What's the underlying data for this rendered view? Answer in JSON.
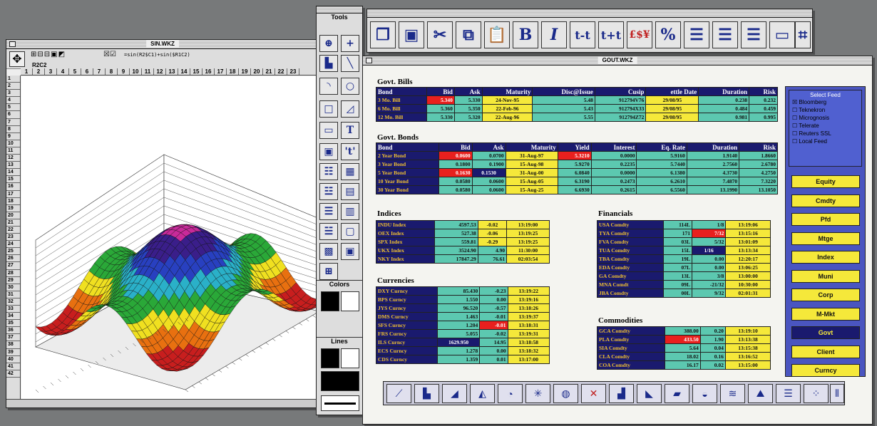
{
  "tools": {
    "title": "Tools",
    "colors_label": "Colors",
    "lines_label": "Lines"
  },
  "sheet": {
    "title": "SIN.WKZ",
    "cell_ref": "R2C2",
    "formula": "=sin(R2$C1)+sin($R1C2)",
    "columns": [
      "1",
      "2",
      "3",
      "4",
      "5",
      "6",
      "7",
      "8",
      "9",
      "10",
      "11",
      "12",
      "13",
      "14",
      "15",
      "16",
      "17",
      "18",
      "19",
      "20",
      "21",
      "22",
      "23"
    ],
    "rows": [
      "1",
      "2",
      "3",
      "4",
      "5",
      "6",
      "7",
      "8",
      "9",
      "10",
      "11",
      "12",
      "13",
      "14",
      "15",
      "16",
      "17",
      "18",
      "19",
      "20",
      "21",
      "22",
      "23",
      "24",
      "25",
      "26",
      "27",
      "28",
      "29",
      "30",
      "31",
      "32",
      "33",
      "34",
      "35",
      "36",
      "37",
      "38",
      "39",
      "40",
      "41",
      "42"
    ]
  },
  "main": {
    "title": "GOUT.WKZ",
    "bills": {
      "title": "Govt. Bills",
      "headers": [
        "Bond",
        "Bid",
        "Ask",
        "Maturity",
        "Disc@Issue",
        "Cusip",
        "ettle Date",
        "Duration",
        "Risk"
      ],
      "rows": [
        [
          "3 Mo. Bill",
          "5.340",
          "5.330",
          "24-Nov-95",
          "5.48",
          "912794V76",
          "29/08/95",
          "0.238",
          "0.232"
        ],
        [
          "6 Mo. Bill",
          "5.360",
          "5.350",
          "22-Feb-96",
          "5.43",
          "912794X33",
          "29/08/95",
          "0.484",
          "0.459"
        ],
        [
          "12 Mo. Bill",
          "5.330",
          "5.320",
          "22-Aug-96",
          "5.55",
          "912794Z72",
          "29/08/95",
          "0.981",
          "0.995"
        ]
      ]
    },
    "bonds": {
      "title": "Govt. Bonds",
      "headers": [
        "Bond",
        "Bid",
        "Ask",
        "Maturity",
        "Yield",
        "Interest",
        "Eq. Rate",
        "Duration",
        "Risk"
      ],
      "rows": [
        [
          "2 Year Bond",
          "0.0600",
          "0.0700",
          "31-Aug-97",
          "5.3210",
          "0.0000",
          "5.9160",
          "1.9140",
          "1.8660"
        ],
        [
          "3 Year Bond",
          "0.1800",
          "0.1900",
          "15-Aug-98",
          "5.9270",
          "0.2235",
          "5.7440",
          "2.7560",
          "2.6780"
        ],
        [
          "5 Year Bond",
          "0.1630",
          "0.1530",
          "31-Aug-00",
          "6.0840",
          "0.0000",
          "6.1380",
          "4.3730",
          "4.2750"
        ],
        [
          "10 Year Bond",
          "0.0580",
          "0.0600",
          "15-Aug-05",
          "6.3190",
          "0.2473",
          "6.2610",
          "7.4870",
          "7.3220"
        ],
        [
          "30 Year Bond",
          "0.0580",
          "0.0600",
          "15-Aug-25",
          "6.6930",
          "0.2615",
          "6.5560",
          "13.1990",
          "13.1050"
        ]
      ]
    },
    "indices": {
      "title": "Indices",
      "rows": [
        [
          "INDU Index",
          "4597.53",
          "-0.02",
          "13:19:00"
        ],
        [
          "OEX Index",
          "527.38",
          "-0.06",
          "13:19:25"
        ],
        [
          "SPX Index",
          "559.81",
          "-0.29",
          "13:19:25"
        ],
        [
          "UKX Index",
          "3524.90",
          "4.90",
          "11:30:00"
        ],
        [
          "NKY Index",
          "17847.29",
          "76.61",
          "02:03:54"
        ]
      ]
    },
    "currencies": {
      "title": "Currencies",
      "rows": [
        [
          "DXY Curncy",
          "85.430",
          "-0.23",
          "13:19:22"
        ],
        [
          "BPS Curncy",
          "1.550",
          "0.00",
          "13:19:16"
        ],
        [
          "JYS Curncy",
          "96.520",
          "-0.57",
          "13:18:26"
        ],
        [
          "DMS Curncy",
          "1.463",
          "-0.01",
          "13:19:37"
        ],
        [
          "SFS Curncy",
          "1.204",
          "-0.01",
          "13:18:31"
        ],
        [
          "FRS Curncy",
          "5.055",
          "-0.02",
          "13:19:31"
        ],
        [
          "ILS Curncy",
          "1629.950",
          "14.95",
          "13:18:58"
        ],
        [
          "ECS Curncy",
          "1.278",
          "0.00",
          "13:18:32"
        ],
        [
          "CDS Curncy",
          "1.359",
          "0.01",
          "13:17:00"
        ]
      ]
    },
    "financials": {
      "title": "Financials",
      "rows": [
        [
          "USA Comdty",
          "114L",
          "1/8",
          "13:19:06"
        ],
        [
          "TYA Comdty",
          "171",
          "7/32",
          "13:15:16"
        ],
        [
          "FVA Comdty",
          "03L",
          "5/32",
          "13:01:09"
        ],
        [
          "TUA Comdty",
          "15L",
          "1/16",
          "13:13:34"
        ],
        [
          "TBA Comdty",
          "19L",
          "0.00",
          "12:20:17"
        ],
        [
          "EDA Comdty",
          "07L",
          "0.00",
          "13:06:25"
        ],
        [
          "GA Comdty",
          "13L",
          "3/8",
          "13:00:00"
        ],
        [
          "MNA Comdt",
          "09L",
          "-21/32",
          "10:30:00"
        ],
        [
          "JBA Comdty",
          "00L",
          "9/32",
          "02:01:31"
        ]
      ]
    },
    "commodities": {
      "title": "Commodities",
      "rows": [
        [
          "GCA Comdty",
          "388.00",
          "0.20",
          "13:19:10"
        ],
        [
          "PLA Comdty",
          "433.50",
          "1.90",
          "13:13:38"
        ],
        [
          "SIA Comdty",
          "5.64",
          "0.04",
          "13:15:38"
        ],
        [
          "CLA Comdty",
          "18.02",
          "0.16",
          "13:16:52"
        ],
        [
          "COA Comdty",
          "16.17",
          "0.02",
          "13:15:00"
        ]
      ]
    }
  },
  "feed": {
    "title": "Select Feed",
    "options": [
      "Bloomberg",
      "Teknekron",
      "Micrognosis",
      "Telerate",
      "Reuters SSL",
      "Local Feed"
    ],
    "checked": "Bloomberg",
    "buttons": [
      "Equity",
      "Cmdty",
      "Pfd",
      "Mtge",
      "Index",
      "Muni",
      "Corp",
      "M-Mkt",
      "Govt",
      "Client",
      "Curncy"
    ],
    "selected": "Govt"
  },
  "colors": {
    "navy": "#1a1a6e",
    "cyan": "#5cc8b0",
    "yellow": "#f5e83a",
    "red": "#e8201e",
    "panel": "#4a55c0"
  }
}
